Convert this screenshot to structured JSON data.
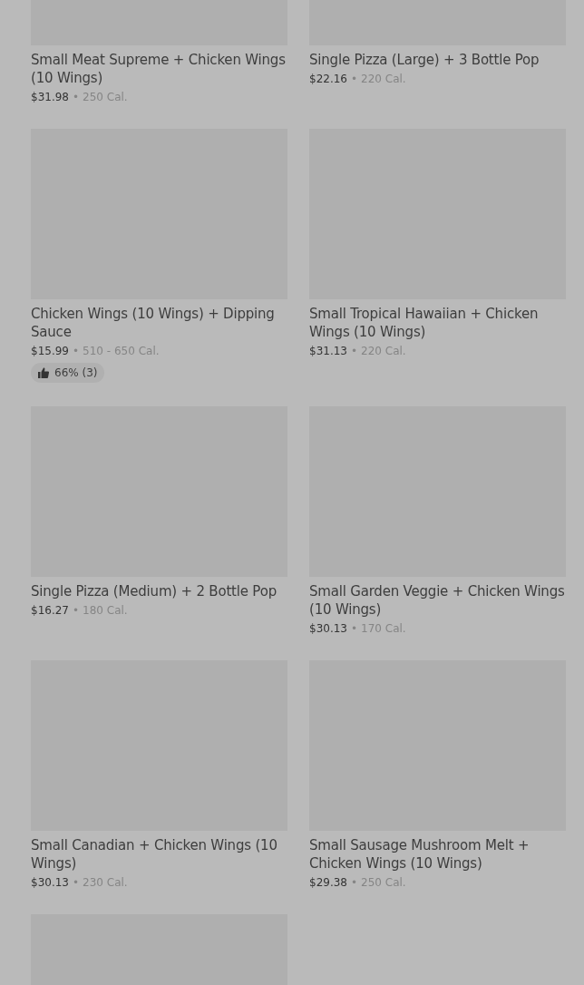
{
  "items": [
    {
      "kind": "product",
      "title": "Small Meat Supreme + Chicken Wings (10 Wings)",
      "price": "$31.98",
      "separator": "•",
      "calories": "250 Cal."
    },
    {
      "kind": "product",
      "title": "Single Pizza (Large) + 3 Bottle Pop",
      "price": "$22.16",
      "separator": "•",
      "calories": "220 Cal."
    },
    {
      "kind": "product",
      "title": "Chicken Wings (10 Wings) + Dipping Sauce",
      "price": "$15.99",
      "separator": "•",
      "calories": "510 - 650 Cal.",
      "rating": "66% (3)"
    },
    {
      "kind": "product",
      "title": "Small Tropical Hawaiian + Chicken Wings (10 Wings)",
      "price": "$31.13",
      "separator": "•",
      "calories": "220 Cal."
    },
    {
      "kind": "product",
      "title": "Single Pizza (Medium) + 2 Bottle Pop",
      "price": "$16.27",
      "separator": "•",
      "calories": "180 Cal."
    },
    {
      "kind": "product",
      "title": "Small Garden Veggie + Chicken Wings (10 Wings)",
      "price": "$30.13",
      "separator": "•",
      "calories": "170 Cal."
    },
    {
      "kind": "product",
      "title": "Small Canadian + Chicken Wings (10 Wings)",
      "price": "$30.13",
      "separator": "•",
      "calories": "230 Cal."
    },
    {
      "kind": "product",
      "title": "Small Sausage Mushroom Melt + Chicken Wings (10 Wings)",
      "price": "$29.38",
      "separator": "•",
      "calories": "250 Cal."
    },
    {
      "kind": "image_only"
    }
  ]
}
